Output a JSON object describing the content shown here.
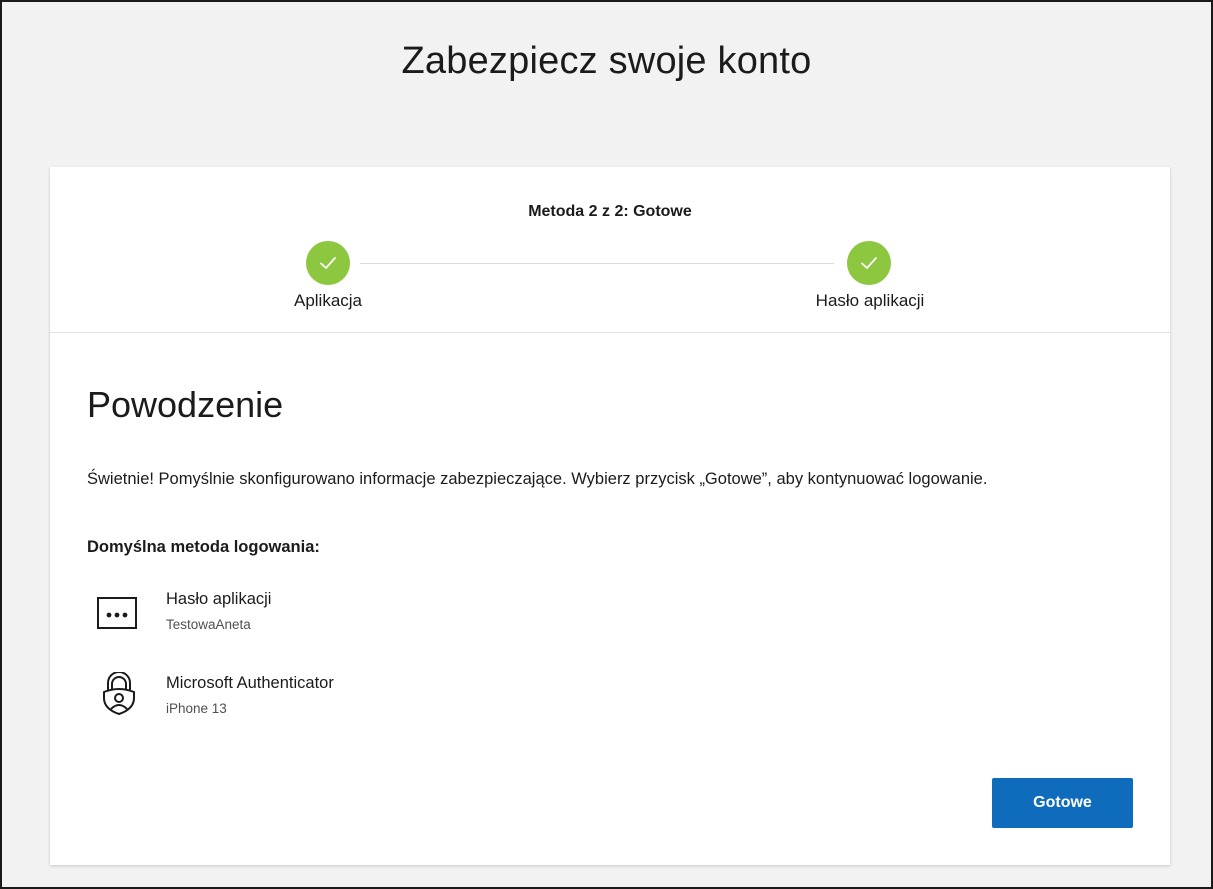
{
  "page": {
    "title": "Zabezpiecz swoje konto"
  },
  "stepper": {
    "heading": "Metoda 2 z 2: Gotowe",
    "steps": [
      {
        "label": "Aplikacja",
        "status": "complete"
      },
      {
        "label": "Hasło aplikacji",
        "status": "complete"
      }
    ],
    "complete_color": "#8dc63f"
  },
  "content": {
    "title": "Powodzenie",
    "description": "Świetnie! Pomyślnie skonfigurowano informacje zabezpieczające. Wybierz przycisk „Gotowe”, aby kontynuować logowanie.",
    "default_method_label": "Domyślna metoda logowania:",
    "methods": [
      {
        "name": "Hasło aplikacji",
        "detail": "TestowaAneta",
        "icon": "password-dots-icon"
      },
      {
        "name": "Microsoft Authenticator",
        "detail": "iPhone 13",
        "icon": "authenticator-lock-icon"
      }
    ]
  },
  "actions": {
    "done_label": "Gotowe",
    "accent_color": "#0f6cbd"
  }
}
